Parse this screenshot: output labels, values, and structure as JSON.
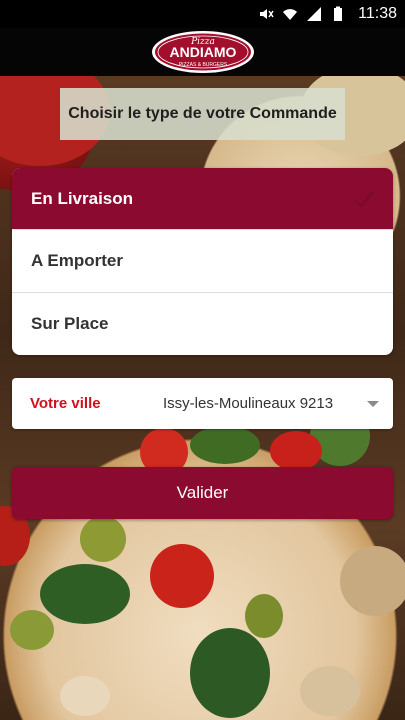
{
  "status_bar": {
    "time": "11:38",
    "icons": [
      "mute-icon",
      "wifi-icon",
      "signal-icon",
      "battery-icon"
    ]
  },
  "header": {
    "logo_script": "Pizza",
    "logo_name": "ANDIAMO",
    "logo_tagline": "PIZZAS & BURGERS",
    "brand_color": "#8a0b2f"
  },
  "title": "Choisir le type de votre Commande",
  "order_types": [
    {
      "label": "En Livraison",
      "selected": true
    },
    {
      "label": "A Emporter",
      "selected": false
    },
    {
      "label": "Sur Place",
      "selected": false
    }
  ],
  "city": {
    "label": "Votre ville",
    "value": "Issy-les-Moulineaux 9213"
  },
  "validate_label": "Valider",
  "colors": {
    "accent": "#8a0b2f",
    "city_label": "#d0101e",
    "title_bg": "#d7decd"
  }
}
